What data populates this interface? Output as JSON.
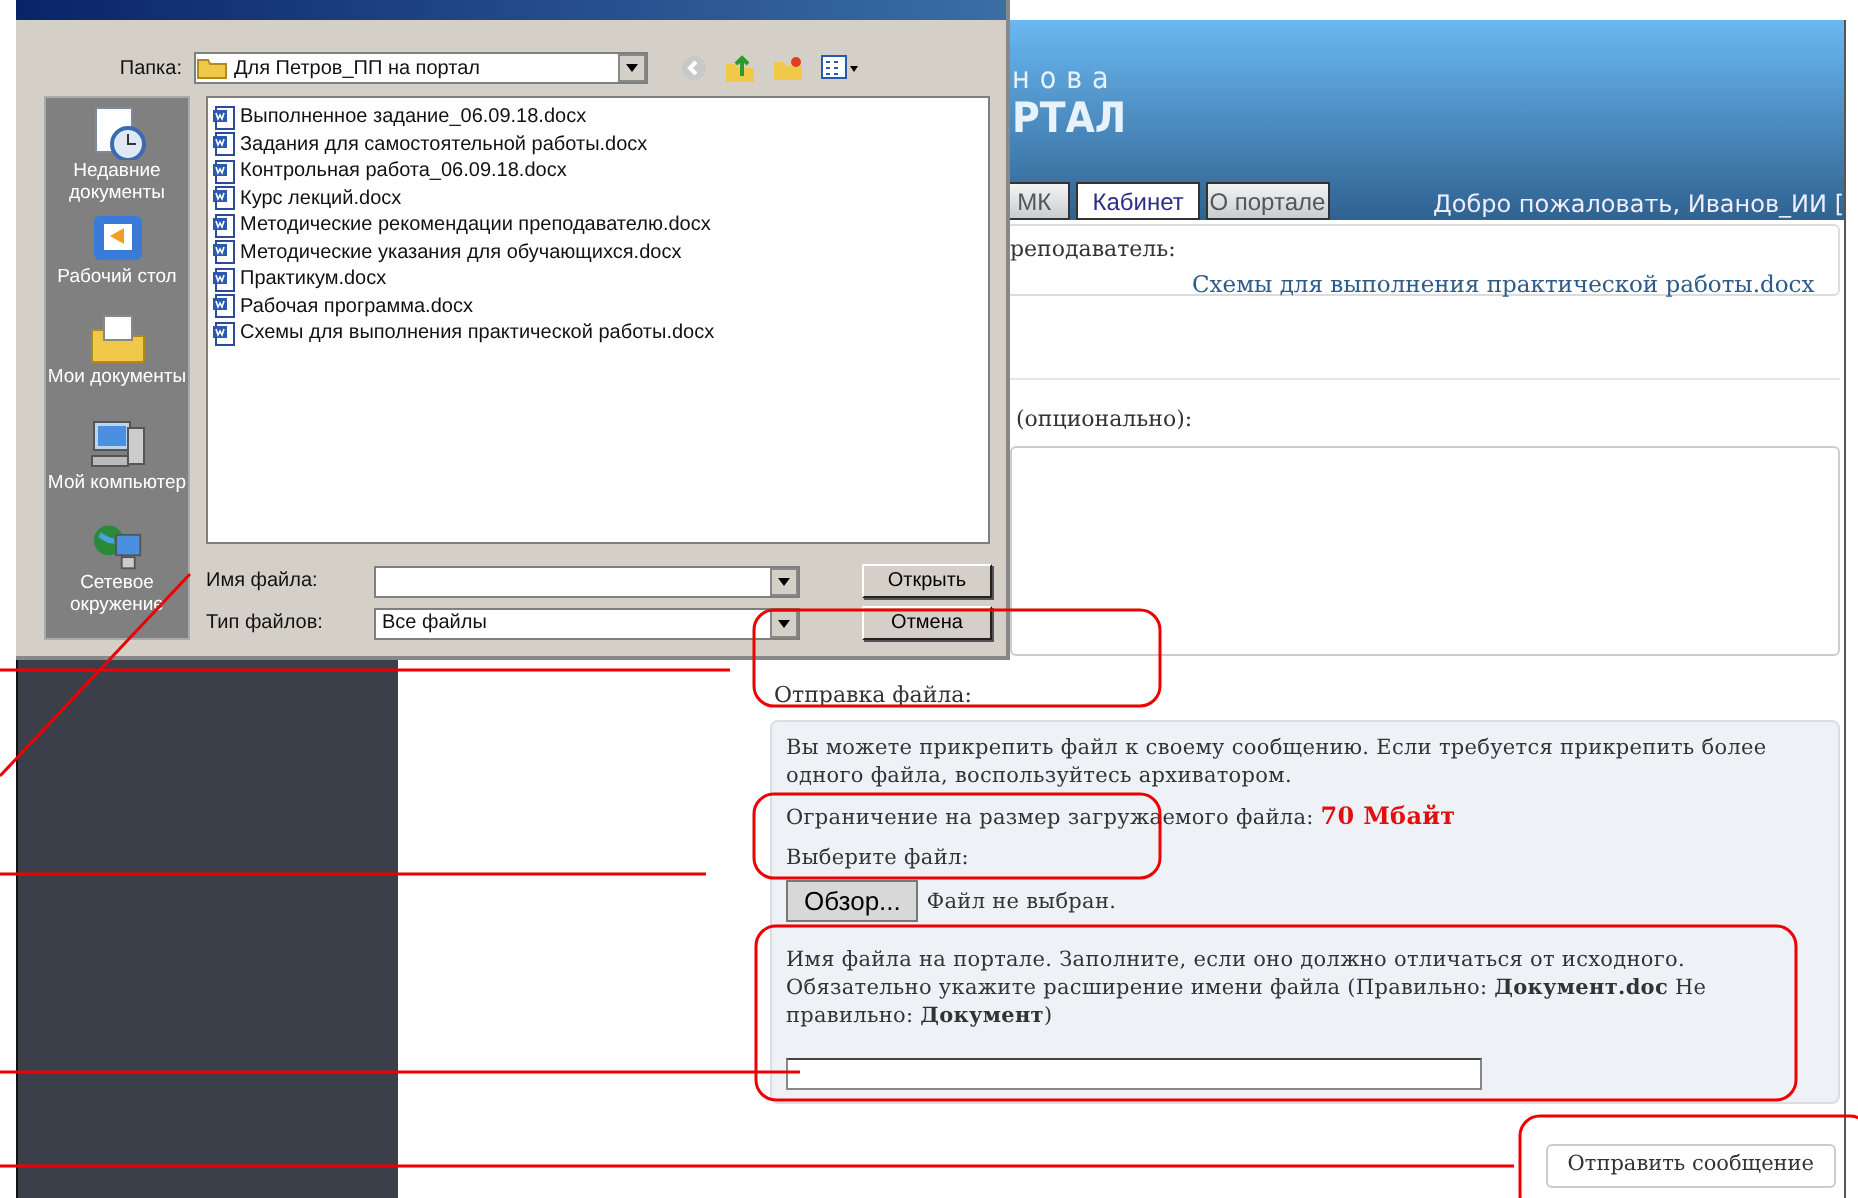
{
  "dialog": {
    "folder_label": "Папка:",
    "folder": "Для Петров_ПП на портал",
    "places": [
      {
        "label": "Недавние документы",
        "kind": "recent"
      },
      {
        "label": "Рабочий стол",
        "kind": "desktop"
      },
      {
        "label": "Мои документы",
        "kind": "documents"
      },
      {
        "label": "Мой компьютер",
        "kind": "computer"
      },
      {
        "label": "Сетевое окружение",
        "kind": "network"
      }
    ],
    "files": [
      "Выполненное задание_06.09.18.docx",
      "Задания для самостоятельной работы.docx",
      "Контрольная работа_06.09.18.docx",
      "Курс лекций.docx",
      "Методические рекомендации преподавателю.docx",
      "Методические указания для обучающихся.docx",
      "Практикум.docx",
      "Рабочая программа.docx",
      "Схемы для выполнения практической работы.docx"
    ],
    "filename_label": "Имя файла:",
    "filetype_label": "Тип файлов:",
    "filetype": "Все файлы",
    "open_button": "Открыть",
    "cancel_button": "Отмена"
  },
  "header": {
    "logo_lines": [
      "нова",
      "РТАЛ"
    ],
    "tabs": [
      {
        "label": "МК",
        "selected": false
      },
      {
        "label": "Кабинет",
        "selected": true
      },
      {
        "label": "О портале",
        "selected": false
      }
    ],
    "welcome": "Добро пожаловать, Иванов_ИИ ["
  },
  "teacher": {
    "label": "реподаватель:",
    "file_link": "Схемы для выполнения практической работы.docx"
  },
  "comment": {
    "label": "(опционально):"
  },
  "upload": {
    "title": "Отправка файла:",
    "intro": "Вы можете прикрепить файл к своему сообщению. Если требуется прикрепить более одного файла, воспользуйтесь архиватором.",
    "limit": "Ограничение на размер загружаемого файла: **70 Мбайт**",
    "choose_label": "Выберите файл:",
    "browse_button": "Обзор...",
    "no_file": "Файл не выбран.",
    "name_hint": "Имя файла на портале. Заполните, если оно должно отличаться от исходного. Обязательно укажите расширение имени файла (Правильно: **Документ.doc** Не правильно: **Документ**)"
  },
  "submit_button": "Отправить сообщение"
}
